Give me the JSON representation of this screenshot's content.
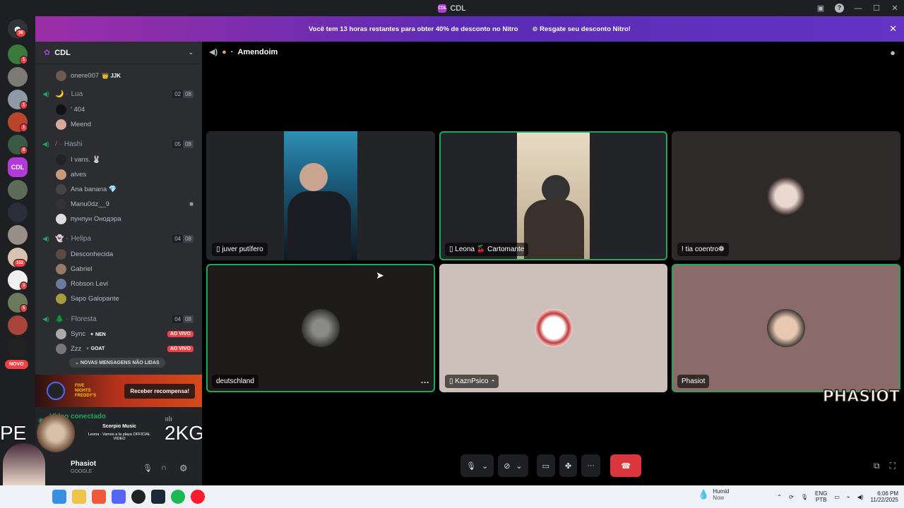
{
  "window": {
    "title": "CDL"
  },
  "banner": {
    "text": "Você tem 13 horas restantes para obter 40% de desconto no Nitro",
    "cta": "Resgate seu desconto Nitro!"
  },
  "guilds": {
    "home_badge": "36",
    "badges": [
      "1",
      "1",
      "1",
      "6",
      "152",
      "3",
      "5"
    ],
    "new_label": "NOVO"
  },
  "server": {
    "name": "CDL",
    "top_user": {
      "name": "onere007",
      "tag": "JJK"
    },
    "channels": [
      {
        "name": "Lua",
        "prefix": "🌙 ·",
        "count": "02",
        "limit": "08",
        "users": [
          "' 404",
          "Meend"
        ]
      },
      {
        "name": "Hashi",
        "prefix": "/ ·",
        "count": "05",
        "limit": "08",
        "users": [
          "I vans. 🐰",
          "alves",
          "Ana banana 💎",
          "Manu0dz__9",
          "пунпун Онодэра"
        ]
      },
      {
        "name": "Helipa",
        "prefix": "👻 ·",
        "count": "04",
        "limit": "08",
        "users": [
          "Desconhecida",
          "Gabriel",
          "Robson Levi",
          "Sapo Galopante"
        ]
      },
      {
        "name": "Floresta",
        "prefix": "🌲 ·",
        "count": "04",
        "limit": "08",
        "users": [
          "Sync",
          "Zzz"
        ]
      }
    ],
    "sync_tag": "NEN",
    "zzz_tag": "GOAT",
    "live_label": "AO VIVO",
    "new_messages": "NOVAS MENSAGENS NÃO LIDAS"
  },
  "promo": {
    "logo": "FIVE NIGHTS FREDDY'S",
    "claim": "Receber recompensa!"
  },
  "voice_panel": {
    "status": "Vídeo conectado",
    "user": "Phasiot",
    "user_sub": "GOOGLE",
    "music_title": "Scorpio Music",
    "music_track": "Leona - Vamos a la playa OFFICIAL VIDEO"
  },
  "overlay": {
    "left": "PE",
    "right": "2KG",
    "logo": "PHASIOT"
  },
  "main": {
    "channel": "Amendoim",
    "tiles": [
      {
        "label": "juver putífero",
        "mobile": true
      },
      {
        "label": "Leona 🍒 Cartomante",
        "mobile": true
      },
      {
        "label": "! tia coentro❁",
        "mobile": false
      },
      {
        "label": "deutschland",
        "mobile": false
      },
      {
        "label": "KaznPsico",
        "mobile": true
      },
      {
        "label": "Phasiot",
        "mobile": false
      }
    ]
  },
  "taskbar": {
    "weather_title": "Humid",
    "weather_sub": "Now",
    "lang": "ENG",
    "lang_sub": "PTB",
    "time": "6:06 PM",
    "date": "11/22/2025"
  },
  "colors": {
    "speaking": "#23a55a",
    "live": "#ed4245",
    "hangup": "#da373c",
    "nitro": "#5b2bb5"
  }
}
